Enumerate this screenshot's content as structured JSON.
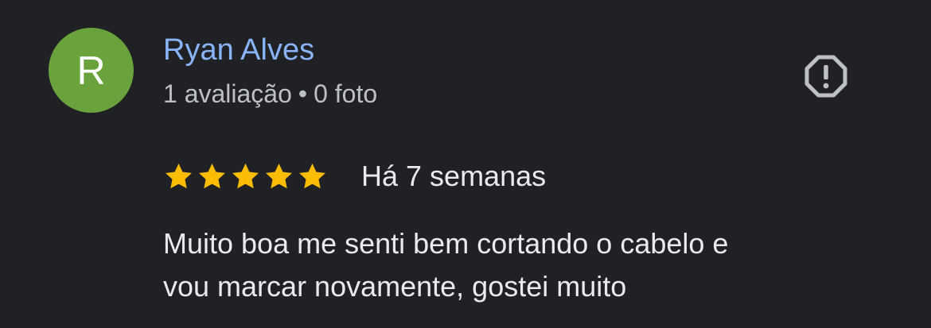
{
  "review": {
    "author": {
      "initial": "R",
      "name": "Ryan Alves",
      "reviews_count": "1 avaliação",
      "separator": "•",
      "photos_count": "0 foto",
      "avatar_color": "#6aa33c",
      "name_color": "#8ab4f8"
    },
    "report_icon": "report-octagon-icon",
    "rating": {
      "value": 5,
      "max": 5,
      "star_color": "#fbbc04"
    },
    "date": "Há 7 semanas",
    "text_lines": [
      "Muito boa me senti bem cortando o cabelo e",
      "vou marcar novamente, gostei muito"
    ]
  }
}
